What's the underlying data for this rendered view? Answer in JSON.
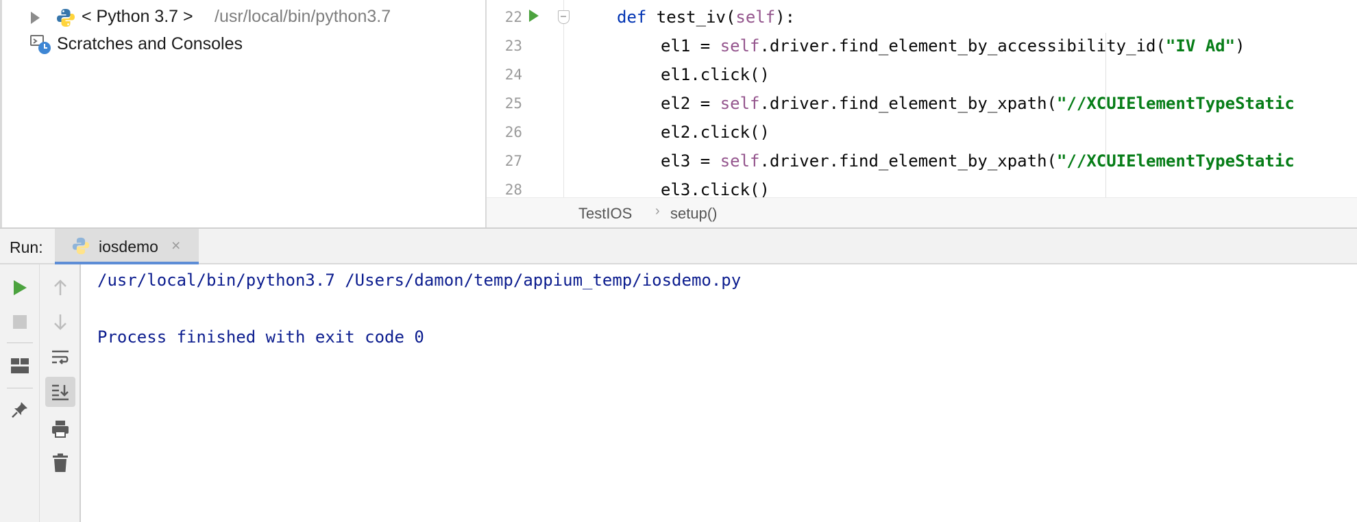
{
  "project_tree": {
    "sdk_node": {
      "label": "< Python 3.7 >",
      "path": "/usr/local/bin/python3.7"
    },
    "scratches": {
      "label": "Scratches and Consoles"
    }
  },
  "editor": {
    "lines": [
      {
        "num": "22"
      },
      {
        "num": "23"
      },
      {
        "num": "24"
      },
      {
        "num": "25"
      },
      {
        "num": "26"
      },
      {
        "num": "27"
      },
      {
        "num": "28"
      }
    ],
    "code": {
      "l22_def": "def",
      "l22_name": " test_iv(",
      "l22_self": "self",
      "l22_end": "):",
      "l23_a": "el1 = ",
      "l23_self": "self",
      "l23_b": ".driver.find_element_by_accessibility_id(",
      "l23_str": "\"IV Ad\"",
      "l23_c": ")",
      "l24": "el1.click()",
      "l25_a": "el2 = ",
      "l25_self": "self",
      "l25_b": ".driver.find_element_by_xpath(",
      "l25_str": "\"//XCUIElementTypeStatic",
      "l26": "el2.click()",
      "l27_a": "el3 = ",
      "l27_self": "self",
      "l27_b": ".driver.find_element_by_xpath(",
      "l27_str": "\"//XCUIElementTypeStatic",
      "l28": "el3.click()"
    },
    "breadcrumb": {
      "class_name": "TestIOS",
      "separator": "›",
      "method_name": "setup()"
    }
  },
  "run_window": {
    "title": "Run:",
    "tab_label": "iosdemo",
    "tab_close": "×",
    "console_lines": {
      "command": "/usr/local/bin/python3.7 /Users/damon/temp/appium_temp/iosdemo.py",
      "result": "Process finished with exit code 0"
    }
  },
  "colors": {
    "keyword": "#0033b3",
    "self": "#94558d",
    "string": "#067d17",
    "console_text": "#0b1c8e",
    "run_green": "#4ca33f",
    "tab_underline": "#5d8dd6"
  },
  "icons": [
    "tree-expand-arrow-icon",
    "python-icon",
    "scratches-icon",
    "run-gutter-icon",
    "fold-icon",
    "rerun-icon",
    "stop-icon",
    "layout-icon",
    "pin-icon",
    "up-arrow-icon",
    "down-arrow-icon",
    "soft-wrap-icon",
    "scroll-to-end-icon",
    "print-icon",
    "trash-icon"
  ]
}
